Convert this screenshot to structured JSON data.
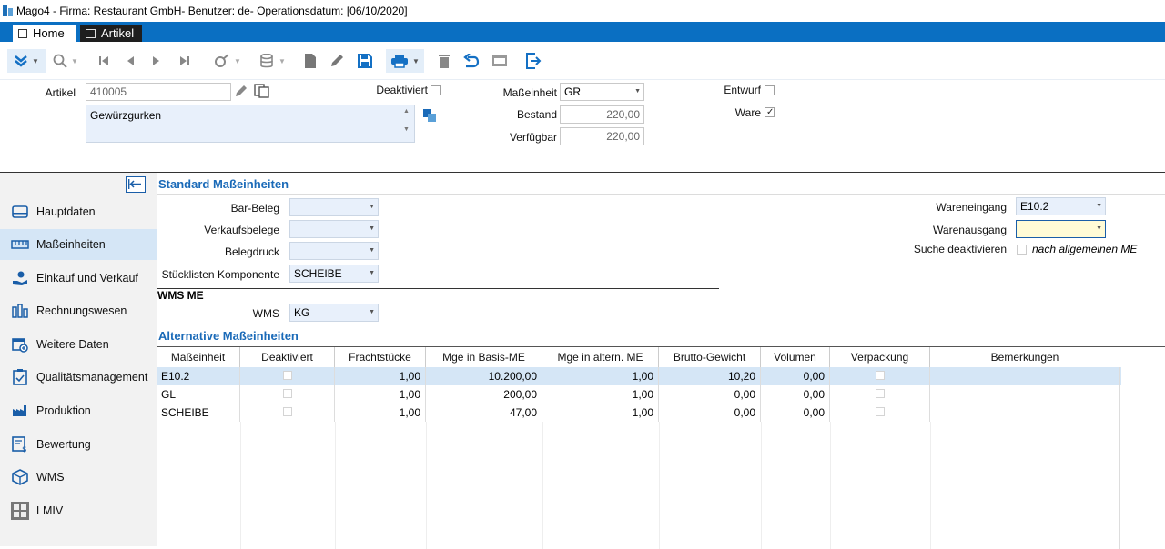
{
  "window": {
    "title": "Mago4 - Firma: Restaurant GmbH- Benutzer: de- Operationsdatum: [06/10/2020]"
  },
  "tabs": [
    {
      "label": "Home"
    },
    {
      "label": "Artikel"
    }
  ],
  "header": {
    "artikel_label": "Artikel",
    "artikel_value": "410005",
    "description": "Gewürzgurken",
    "deaktiviert_label": "Deaktiviert",
    "masseinheit_label": "Maßeinheit",
    "masseinheit_value": "GR",
    "bestand_label": "Bestand",
    "bestand_value": "220,00",
    "verfuegbar_label": "Verfügbar",
    "verfuegbar_value": "220,00",
    "entwurf_label": "Entwurf",
    "ware_label": "Ware",
    "ware_checked": true
  },
  "sidebar": {
    "items": [
      {
        "label": "Hauptdaten",
        "icon": "card-icon"
      },
      {
        "label": "Maßeinheiten",
        "icon": "ruler-icon",
        "selected": true
      },
      {
        "label": "Einkauf und Verkauf",
        "icon": "hand-coins-icon"
      },
      {
        "label": "Rechnungswesen",
        "icon": "accounting-icon"
      },
      {
        "label": "Weitere Daten",
        "icon": "calendar-plus-icon"
      },
      {
        "label": "Qualitätsmanagement",
        "icon": "clipboard-check-icon"
      },
      {
        "label": "Produktion",
        "icon": "factory-icon"
      },
      {
        "label": "Bewertung",
        "icon": "valuation-icon"
      },
      {
        "label": "WMS",
        "icon": "cube-icon"
      },
      {
        "label": "LMIV",
        "icon": "grid-icon"
      }
    ]
  },
  "standard": {
    "title": "Standard Maßeinheiten",
    "bar_beleg_label": "Bar-Beleg",
    "bar_beleg_value": "",
    "verkaufsbelege_label": "Verkaufsbelege",
    "verkaufsbelege_value": "",
    "belegdruck_label": "Belegdruck",
    "belegdruck_value": "",
    "stueckliste_label": "Stücklisten Komponente",
    "stueckliste_value": "SCHEIBE",
    "wareneingang_label": "Wareneingang",
    "wareneingang_value": "E10.2",
    "warenausgang_label": "Warenausgang",
    "warenausgang_value": "",
    "suche_label": "Suche deaktivieren",
    "suche_hint": "nach allgemeinen ME"
  },
  "wms": {
    "title": "WMS ME",
    "label": "WMS",
    "value": "KG"
  },
  "alternative": {
    "title": "Alternative Maßeinheiten",
    "columns": [
      "Maßeinheit",
      "Deaktiviert",
      "Frachtstücke",
      "Mge in Basis-ME",
      "Mge in altern. ME",
      "Brutto-Gewicht",
      "Volumen",
      "Verpackung",
      "Bemerkungen"
    ],
    "rows": [
      {
        "me": "E10.2",
        "fracht": "1,00",
        "basis": "10.200,00",
        "altern": "1,00",
        "brutto": "10,20",
        "volumen": "0,00"
      },
      {
        "me": "GL",
        "fracht": "1,00",
        "basis": "200,00",
        "altern": "1,00",
        "brutto": "0,00",
        "volumen": "0,00"
      },
      {
        "me": "SCHEIBE",
        "fracht": "1,00",
        "basis": "47,00",
        "altern": "1,00",
        "brutto": "0,00",
        "volumen": "0,00"
      }
    ]
  },
  "colors": {
    "accent": "#0a6fc2",
    "section": "#1a6ab8",
    "selected_row": "#d5e6f6",
    "highlight_field": "#fffbd6"
  }
}
